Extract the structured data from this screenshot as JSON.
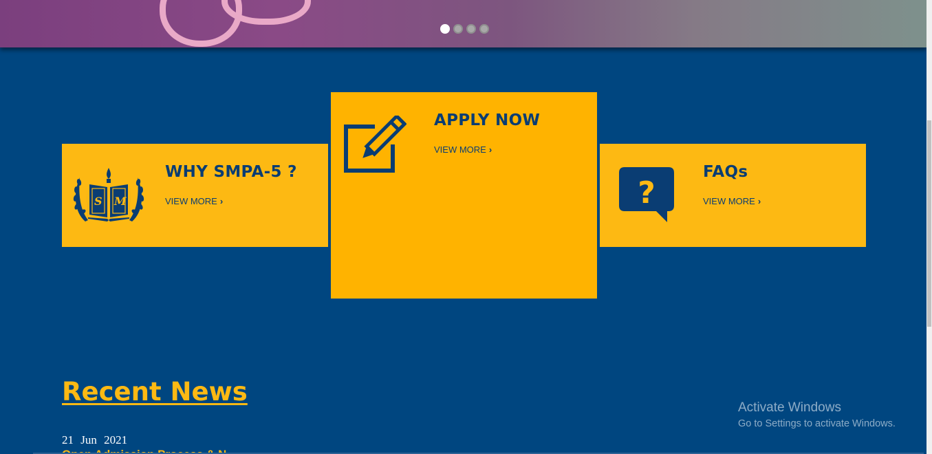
{
  "slider": {
    "dots": 4,
    "active_dot": 1
  },
  "cards": [
    {
      "title": "WHY SMPA-5 ?",
      "link": "VIEW MORE",
      "icon": "school-emblem-icon",
      "emblem_text": "S M"
    },
    {
      "title": "APPLY NOW",
      "link": "VIEW MORE",
      "icon": "edit-pencil-icon"
    },
    {
      "title": "FAQs",
      "link": "VIEW MORE",
      "icon": "question-bubble-icon"
    }
  ],
  "news": {
    "heading": "Recent News",
    "items": [
      {
        "date": "21 Jun 2021",
        "title": "Open Admission Process & N..."
      }
    ]
  },
  "windows_notice": {
    "title": "Activate Windows",
    "subtitle": "Go to Settings to activate Windows."
  },
  "colors": {
    "background": "#004680",
    "accent": "#fdb913",
    "accent_featured": "#ffb300",
    "text_dark": "#0a3d73"
  }
}
